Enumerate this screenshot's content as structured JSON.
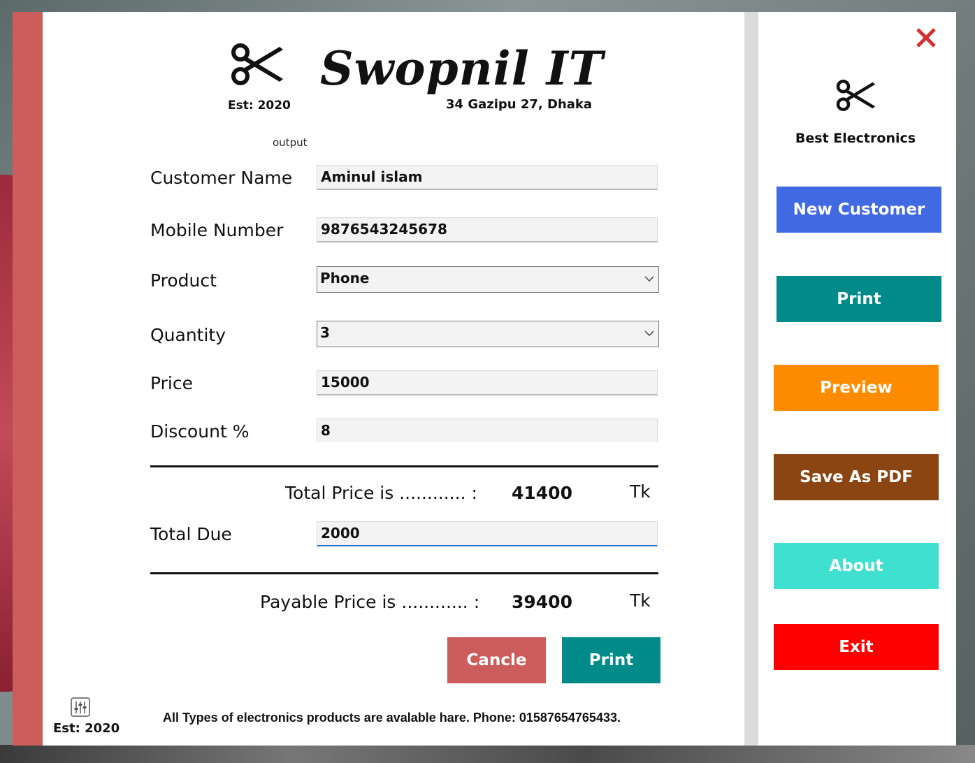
{
  "header": {
    "brand": "Swopnil IT",
    "est": "Est: 2020",
    "address": "34 Gazipu 27, Dhaka",
    "output_label": "output"
  },
  "form": {
    "customer_name": {
      "label": "Customer Name",
      "value": "Aminul islam"
    },
    "mobile_number": {
      "label": "Mobile Number",
      "value": "9876543245678"
    },
    "product": {
      "label": "Product",
      "value": "Phone"
    },
    "quantity": {
      "label": "Quantity",
      "value": "3"
    },
    "price": {
      "label": "Price",
      "value": "15000"
    },
    "discount": {
      "label": "Discount %",
      "value": "8"
    },
    "total_due": {
      "label": "Total Due",
      "value": "2000"
    }
  },
  "summary": {
    "total_label": "Total Price is ............  :",
    "total_value": "41400",
    "payable_label": "Payable Price is ............  :",
    "payable_value": "39400",
    "currency": "Tk"
  },
  "actions": {
    "cancel": "Cancle",
    "print": "Print"
  },
  "footer": {
    "text": "All Types of electronics products are avalable hare.  Phone: 01587654765433.",
    "est": "Est: 2020"
  },
  "sidebar": {
    "brand": "Best Electronics",
    "buttons": {
      "new_customer": "New Customer",
      "print": "Print",
      "preview": "Preview",
      "save_pdf": "Save As PDF",
      "about": "About",
      "exit": "Exit"
    }
  },
  "colors": {
    "stripe": "#cd5c5c",
    "new_customer": "#4169e1",
    "print": "#008b8b",
    "preview": "#ff8c00",
    "save_pdf": "#8b4513",
    "about": "#40e0d0",
    "exit": "#ff0000",
    "cancel": "#cd5c5c",
    "close": "#d32f2f"
  }
}
